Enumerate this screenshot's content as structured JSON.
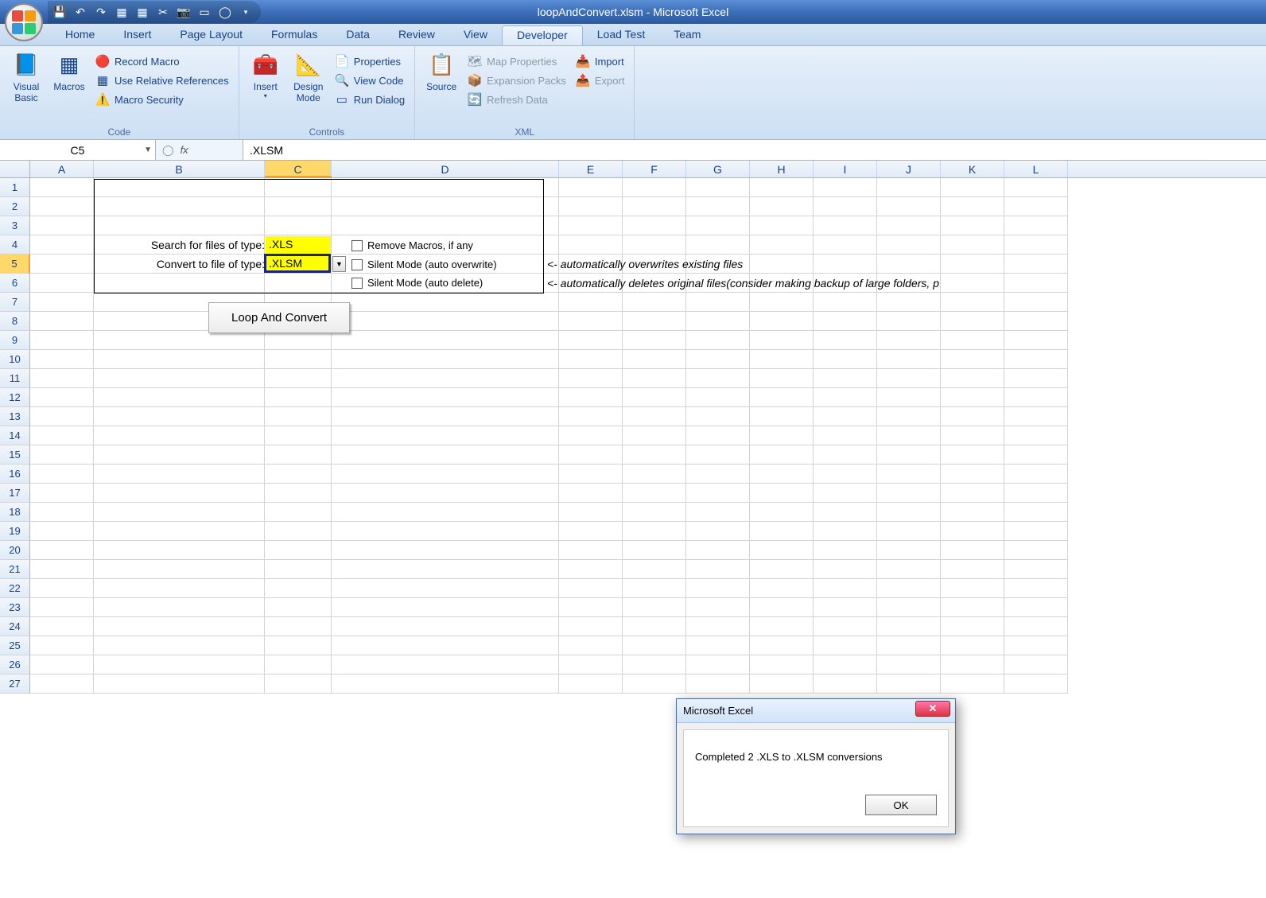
{
  "title": "loopAndConvert.xlsm - Microsoft Excel",
  "tabs": [
    "Home",
    "Insert",
    "Page Layout",
    "Formulas",
    "Data",
    "Review",
    "View",
    "Developer",
    "Load Test",
    "Team"
  ],
  "active_tab": 7,
  "ribbon": {
    "code": {
      "label": "Code",
      "visual_basic": "Visual Basic",
      "macros": "Macros",
      "record_macro": "Record Macro",
      "use_rel": "Use Relative References",
      "macro_sec": "Macro Security"
    },
    "controls": {
      "label": "Controls",
      "insert": "Insert",
      "design": "Design Mode",
      "properties": "Properties",
      "view_code": "View Code",
      "run_dialog": "Run Dialog"
    },
    "xml": {
      "label": "XML",
      "source": "Source",
      "map_props": "Map Properties",
      "expansion": "Expansion Packs",
      "refresh": "Refresh Data",
      "import": "Import",
      "export": "Export"
    }
  },
  "name_box": "C5",
  "formula_value": ".XLSM",
  "columns": [
    "A",
    "B",
    "C",
    "D",
    "E",
    "F",
    "G",
    "H",
    "I",
    "J",
    "K",
    "L"
  ],
  "row_count": 27,
  "selected_col_index": 2,
  "selected_row_index": 4,
  "sheet": {
    "label_search": "Search for files of type:",
    "label_convert": "Convert to file of type:",
    "val_search": ".XLS",
    "val_convert": ".XLSM",
    "chk_remove": "Remove Macros, if any",
    "chk_silent_over": "Silent Mode (auto overwrite)",
    "chk_silent_del": "Silent Mode (auto delete)",
    "btn_loop": "Loop And Convert",
    "note_over": "<- automatically overwrites existing files",
    "note_del": "<- automatically deletes original files(consider making backup of large folders, p"
  },
  "dialog": {
    "title": "Microsoft Excel",
    "message": "Completed 2 .XLS to .XLSM conversions",
    "ok": "OK"
  }
}
